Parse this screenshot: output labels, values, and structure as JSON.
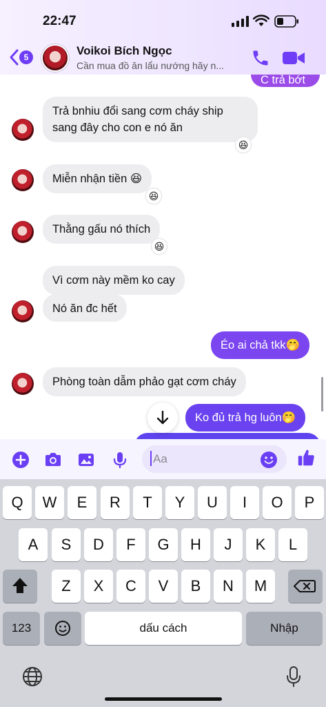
{
  "status_bar": {
    "time": "22:47"
  },
  "header": {
    "unread_count": "5",
    "contact_name": "Voikoi Bích Ngọc",
    "contact_status": "Cần mua đồ ăn lẩu nướng hãy n...",
    "colors": {
      "accent": "#6e3df5",
      "header_bg": "#efe6ff"
    }
  },
  "messages": [
    {
      "from": "me",
      "text": "C trả bớt",
      "partial": true
    },
    {
      "from": "them",
      "text_line1": "Trả bnhiu đổi sang cơm cháy ship",
      "text_line2": "sang đây cho con e nó ăn",
      "reaction": "😆"
    },
    {
      "from": "them",
      "text": "Miễn nhận tiền 😆",
      "reaction": "😆"
    },
    {
      "from": "them",
      "text": "Thằng gấu nó thích",
      "reaction": "😆"
    },
    {
      "from": "them",
      "text": "Vì cơm này mềm ko cay"
    },
    {
      "from": "them",
      "text": "Nó ăn đc hết"
    },
    {
      "from": "me",
      "text": "Éo ai chả tkk🤭"
    },
    {
      "from": "them",
      "text": "Phòng toàn dẫm phảo gạt cơm cháy"
    },
    {
      "from": "me",
      "text": "Ko đủ trả hg luôn🤭"
    }
  ],
  "composer": {
    "placeholder": "Aa",
    "icons": [
      "plus-icon",
      "camera-icon",
      "gallery-icon",
      "microphone-icon",
      "emoji-icon",
      "thumbs-up-icon"
    ]
  },
  "keyboard": {
    "row1": [
      "Q",
      "W",
      "E",
      "R",
      "T",
      "Y",
      "U",
      "I",
      "O",
      "P"
    ],
    "row2": [
      "A",
      "S",
      "D",
      "F",
      "G",
      "H",
      "J",
      "K",
      "L"
    ],
    "row3": [
      "Z",
      "X",
      "C",
      "V",
      "B",
      "N",
      "M"
    ],
    "numbers_key": "123",
    "space_label": "dấu cách",
    "return_label": "Nhập",
    "icons": [
      "shift-icon",
      "backspace-icon",
      "emoji-keyboard-icon",
      "globe-icon",
      "dictation-icon"
    ]
  }
}
